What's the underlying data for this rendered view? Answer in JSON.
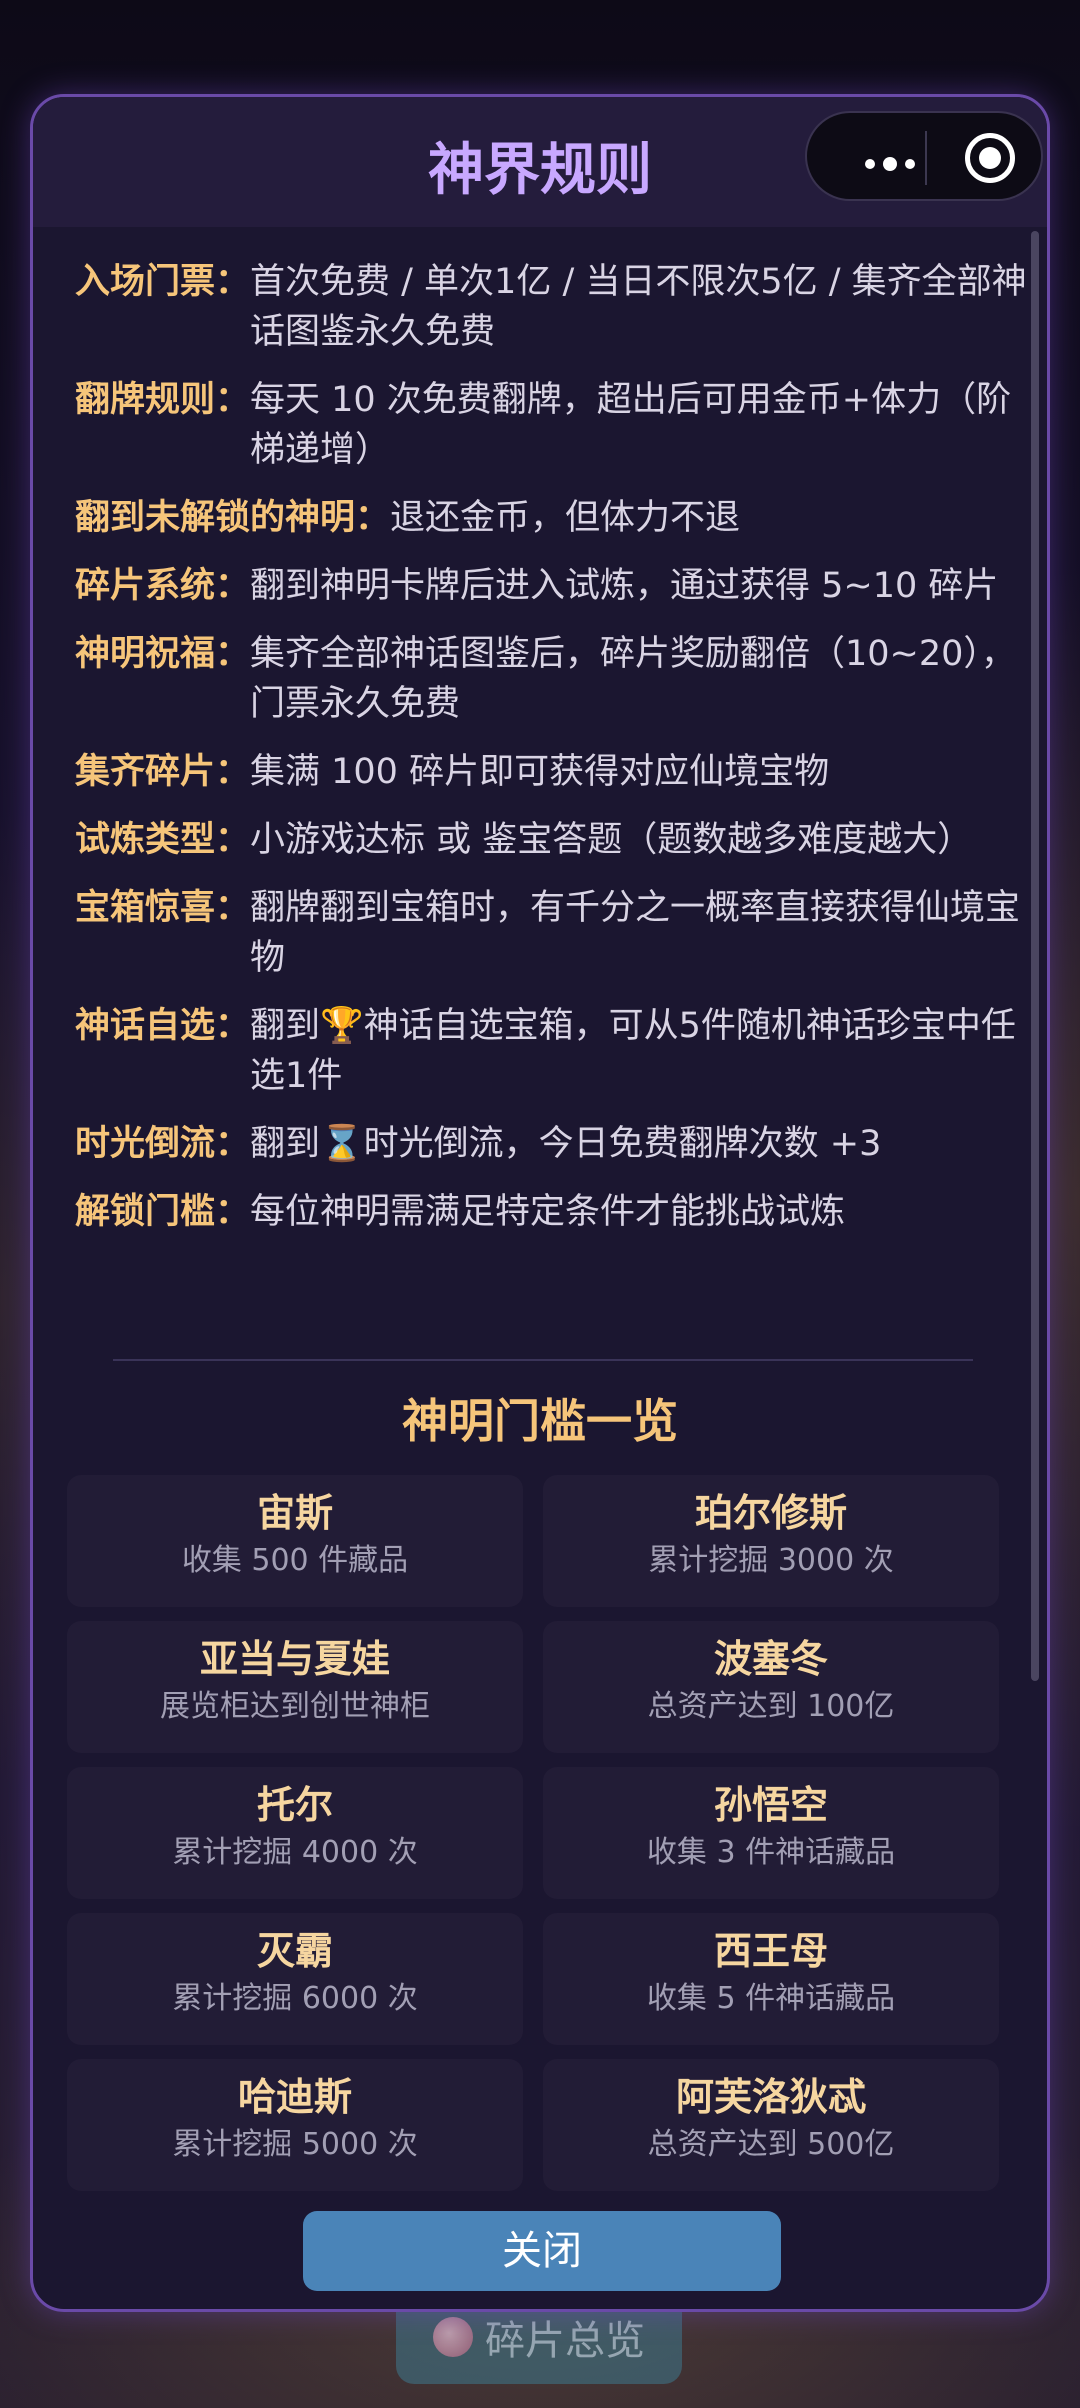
{
  "background_button": {
    "label": "碎片总览"
  },
  "modal": {
    "title": "神界规则",
    "rules": [
      {
        "key": "入场门票：",
        "value": "首次免费 / 单次1亿 / 当日不限次5亿 / 集齐全部神话图鉴永久免费"
      },
      {
        "key": "翻牌规则：",
        "value": "每天 10 次免费翻牌，超出后可用金币+体力（阶梯递增）"
      },
      {
        "key": "翻到未解锁的神明：",
        "value": "退还金币，但体力不退"
      },
      {
        "key": "碎片系统：",
        "value": "翻到神明卡牌后进入试炼，通过获得 5~10 碎片"
      },
      {
        "key": "神明祝福：",
        "value": "集齐全部神话图鉴后，碎片奖励翻倍（10~20），门票永久免费"
      },
      {
        "key": "集齐碎片：",
        "value": "集满 100 碎片即可获得对应仙境宝物"
      },
      {
        "key": "试炼类型：",
        "value": "小游戏达标 或 鉴宝答题（题数越多难度越大）"
      },
      {
        "key": "宝箱惊喜：",
        "value": "翻牌翻到宝箱时，有千分之一概率直接获得仙境宝物"
      },
      {
        "key": "神话自选：",
        "value_pre": "翻到",
        "icon": "trophy-icon",
        "icon_char": "🏆",
        "value_post": "神话自选宝箱，可从5件随机神话珍宝中任选1件"
      },
      {
        "key": "时光倒流：",
        "value_pre": "翻到",
        "icon": "hourglass-icon",
        "icon_char": "⌛",
        "value_post": "时光倒流，今日免费翻牌次数 +3"
      },
      {
        "key": "解锁门槛：",
        "value": "每位神明需满足特定条件才能挑战试炼"
      }
    ],
    "threshold_title": "神明门槛一览",
    "gods": [
      {
        "name": "宙斯",
        "cond": "收集 500 件藏品"
      },
      {
        "name": "珀尔修斯",
        "cond": "累计挖掘 3000 次"
      },
      {
        "name": "亚当与夏娃",
        "cond": "展览柜达到创世神柜"
      },
      {
        "name": "波塞冬",
        "cond": "总资产达到 100亿"
      },
      {
        "name": "托尔",
        "cond": "累计挖掘 4000 次"
      },
      {
        "name": "孙悟空",
        "cond": "收集 3 件神话藏品"
      },
      {
        "name": "灭霸",
        "cond": "累计挖掘 6000 次"
      },
      {
        "name": "西王母",
        "cond": "收集 5 件神话藏品"
      },
      {
        "name": "哈迪斯",
        "cond": "累计挖掘 5000 次"
      },
      {
        "name": "阿芙洛狄忒",
        "cond": "总资产达到 500亿"
      }
    ],
    "close_label": "关闭"
  },
  "capsule": {
    "more_icon": "more-dots-icon",
    "close_icon": "target-close-icon"
  }
}
